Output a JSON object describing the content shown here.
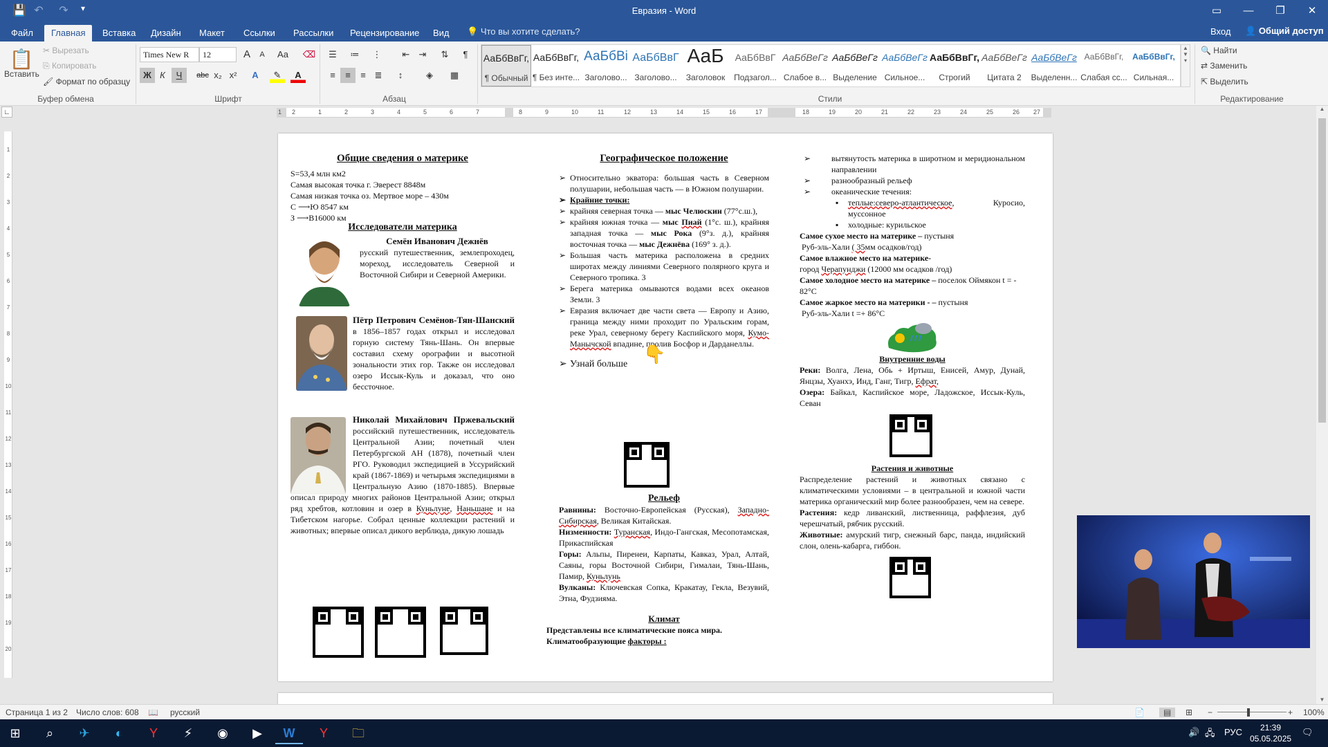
{
  "window": {
    "title": "Евразия - Word",
    "controls": {
      "min": "—",
      "max": "❐",
      "close": "✕",
      "ribbon_display": "▭"
    }
  },
  "quick_access": {
    "save": "💾",
    "undo": "↶",
    "redo": "↷",
    "customize": "▾"
  },
  "tabs": [
    {
      "label": "Файл"
    },
    {
      "label": "Главная"
    },
    {
      "label": "Вставка"
    },
    {
      "label": "Дизайн"
    },
    {
      "label": "Макет"
    },
    {
      "label": "Ссылки"
    },
    {
      "label": "Рассылки"
    },
    {
      "label": "Рецензирование"
    },
    {
      "label": "Вид"
    }
  ],
  "tell_me": "Что вы хотите сделать?",
  "sign_in": "Вход",
  "share": "Общий доступ",
  "clipboard": {
    "paste": "Вставить",
    "cut": "Вырезать",
    "copy": "Копировать",
    "format_painter": "Формат по образцу",
    "label": "Буфер обмена"
  },
  "font": {
    "name": "Times New R",
    "size": "12",
    "bold": "Ж",
    "italic": "К",
    "underline": "Ч",
    "strike": "abc",
    "sub": "x₂",
    "sup": "x²",
    "case": "Aa",
    "grow": "A",
    "shrink": "A",
    "label": "Шрифт"
  },
  "paragraph": {
    "label": "Абзац"
  },
  "styles": {
    "label": "Стили",
    "items": [
      {
        "preview": "АаБбВвГг,",
        "name": "¶ Обычный"
      },
      {
        "preview": "АаБбВвГг,",
        "name": "¶ Без инте..."
      },
      {
        "preview": "АаБбВі",
        "name": "Заголово..."
      },
      {
        "preview": "АаБбВвГ",
        "name": "Заголово..."
      },
      {
        "preview": "АаБ",
        "name": "Заголовок"
      },
      {
        "preview": "АаБбВвГ",
        "name": "Подзагол..."
      },
      {
        "preview": "АаБбВеГг",
        "name": "Слабое в..."
      },
      {
        "preview": "АаБбВеГг",
        "name": "Выделение"
      },
      {
        "preview": "АаБбВеГг",
        "name": "Сильное..."
      },
      {
        "preview": "АаБбВвГг,",
        "name": "Строгий"
      },
      {
        "preview": "АаБбВеГг",
        "name": "Цитата 2"
      },
      {
        "preview": "АаБбВеГг",
        "name": "Выделенн..."
      },
      {
        "preview": "АаБбВвГг,",
        "name": "Слабая сс..."
      },
      {
        "preview": "АаБбВвГг,",
        "name": "Сильная..."
      }
    ]
  },
  "editing": {
    "find": "Найти",
    "replace": "Заменить",
    "select": "Выделить",
    "label": "Редактирование"
  },
  "ruler_numbers": [
    "1",
    "2",
    "1",
    "2",
    "3",
    "4",
    "5",
    "6",
    "7",
    "8",
    "9",
    "10",
    "11",
    "12",
    "13",
    "14",
    "15",
    "16",
    "17",
    "18",
    "19",
    "20",
    "21",
    "22",
    "23",
    "24",
    "25",
    "26",
    "27",
    "28",
    "29"
  ],
  "vruler_numbers": [
    "1",
    "2",
    "3",
    "4",
    "5",
    "6",
    "7",
    "8",
    "9",
    "10",
    "11",
    "12",
    "13",
    "14",
    "15",
    "16",
    "17",
    "18",
    "19",
    "20"
  ],
  "doc": {
    "col1": {
      "h1": "Общие сведения о материке",
      "facts": [
        "S=53,4 млн км2",
        "Самая высокая точка г. Эверест 8848м",
        "Самая низкая точка оз. Мертвое море – 430м"
      ],
      "cs_c": "С",
      "cs_c_val": "Ю 8547 км",
      "cs_z": "З",
      "cs_z_val": "В16000 км",
      "h2": "Исследователи материка",
      "p1_name": "Семён Иванович Дежнёв",
      "p1_text": "русский путешественник, землепроходец, мореход, исследователь Северной и Восточной Сибири и Северной Америки.",
      "p2_name": "Пётр Петрович Семёнов-Тян-Шанский",
      "p2_text": "в 1856–1857 годах открыл и исследовал горную систему Тянь-Шань. Он впервые составил схему орографии и высотной зональности этих гор. Также он исследовал озеро Иссык-Куль и доказал, что оно бессточное.",
      "p3_name": "Николай Михайлович Пржевальский",
      "p3_text_a": "российский путешественник, исследователь Центральной Азии; почетный член Петербургской АН (1878), почетный член РГО. Руководил экспедицией в Уссурийский край (1867-1869) и четырьмя экспедициями в Центральную Азию (1870-1885). Впервые описал природу многих районов Центральной Азии; открыл ряд хребтов, котловин и озер в",
      "p3_w1": "Куньлуне",
      "p3_sep": ",",
      "p3_w2": "Наньшане",
      "p3_text_b": "и на Тибетском нагорье. Собрал ценные коллекции растений и животных; впервые описал дикого верблюда, дикую лошадь"
    },
    "col2": {
      "h1": "Географическое положение",
      "b1": "Относительно экватора: большая часть в Северном полушарии, небольшая часть — в Южном полушарии.",
      "b2": "Крайние точки:",
      "b3_a": "крайняя северная точка —",
      "b3_b": "мыс Челюскин",
      "b3_c": "(77°с.ш.),",
      "b4_a": "крайняя южная точка —",
      "b4_b": "мыс",
      "b4_c": "Пиай",
      "b4_d": "(1°с. ш.),",
      "b4_e": "крайняя западная точка —",
      "b4_f": "мыс Рока",
      "b4_g": "(9°з. д.),",
      "b4_h": "крайняя восточная точка —",
      "b4_i": "мыс Дежнёва",
      "b4_j": "(169° з. д.).",
      "b5": "Большая часть материка расположена в средних широтах между линиями Северного полярного круга и Северного тропика. 3",
      "b6": "Берега материка омываются водами всех океанов Земли. 3",
      "b7_a": "Евразия включает две части света — Европу и Азию, граница между ними проходит по Уральским горам, реке Урал, северному берегу Каспийского моря,",
      "b7_b": "Кумо-Манычской",
      "b7_c": "впадине, пролив Босфор и Дарданеллы.",
      "learn_more": "Узнай больше",
      "h2": "Рельеф",
      "plains_l": "Равнины:",
      "plains_a": "Восточно-Европейская (Русская),",
      "plains_b": "Западно-Сибирская",
      "plains_c": ", Великая Китайская.",
      "low_l": "Низменности:",
      "low_a": "Туранская",
      "low_b": ", Индо-Гангская, Месопотамская, Прикаспийская",
      "mnt_l": "Горы:",
      "mnt_a": "Альпы, Пиренеи, Карпаты, Кавказ, Урал, Алтай, Саяны, горы Восточной Сибири, Гималаи, Тянь-Шань, Памир,",
      "mnt_b": "Куньлунь",
      "vol_l": "Вулканы:",
      "vol_a": "Ключевская Сопка, Кракатау, Гекла, Везувий, Этна, Фудзияма.",
      "h3": "Климат",
      "cl1": "Представлены все климатические пояса мира.",
      "cl2_a": "Климатообразующие",
      "cl2_b": "факторы :"
    },
    "col3": {
      "c1": "вытянутость материка в широтном и меридиональном направлении",
      "c2": "разнообразный рельеф",
      "c3": "океанические течения:",
      "c4_a": "теплые:северо-атлантическое",
      "c4_b": ", Куросио, муссонное",
      "c5": "холодные: курильское",
      "dry_l": "Самое сухое место на материке –",
      "dry_r": "пустыня",
      "dry2_a": "Руб-эль-Хали",
      "dry2_b": "( 35",
      "dry2_c": "мм осадков/год)",
      "wet_l": "Самое влажное место на материке-",
      "wet2_a": "город",
      "wet2_b": "Черапунджи",
      "wet2_c": "(12000 мм осадков /год)",
      "cold_l": "Самое холодное место на материке –",
      "cold_r": "поселок Оймякон t = - 82°C",
      "hot_l": "Самое жаркое место на материки - –",
      "hot_r": "пустыня",
      "hot2": "Руб-эль-Хали t =+ 86°C",
      "h_water": "Внутренние воды",
      "rivers_l": "Реки:",
      "rivers_a": "Волга, Лена, Обь + Иртыш, Енисей, Амур, Дунай, Янцзы, Хуанхэ, Инд, Ганг, Тигр,",
      "rivers_b": "Ефрат",
      "rivers_c": ",",
      "lakes_l": "Озера:",
      "lakes_a": "Байкал, Каспийское море, Ладожское, Иссык-Куль, Севан",
      "h_bio": "Растения и животные",
      "bio1": "Распределение растений и животных связано с климатическими условиями – в центральной и южной части материка органический мир более разнообразен, чем на севере.",
      "plants_l": "Растения:",
      "plants_a": "кедр ливанский, лиственница, раффлезия, дуб черешчатый, рябчик русский.",
      "animals_l": "Животные:",
      "animals_a": "амурский тигр, снежный барс, панда, индийский слон, олень-кабарга, гиббон."
    }
  },
  "status": {
    "page": "Страница 1 из 2",
    "words": "Число слов: 608",
    "lang": "русский",
    "zoom": "100%",
    "zoom_level": 1.0
  },
  "taskbar": {
    "time": "21:39",
    "date": "05.05.2025",
    "lang": "РУС"
  }
}
